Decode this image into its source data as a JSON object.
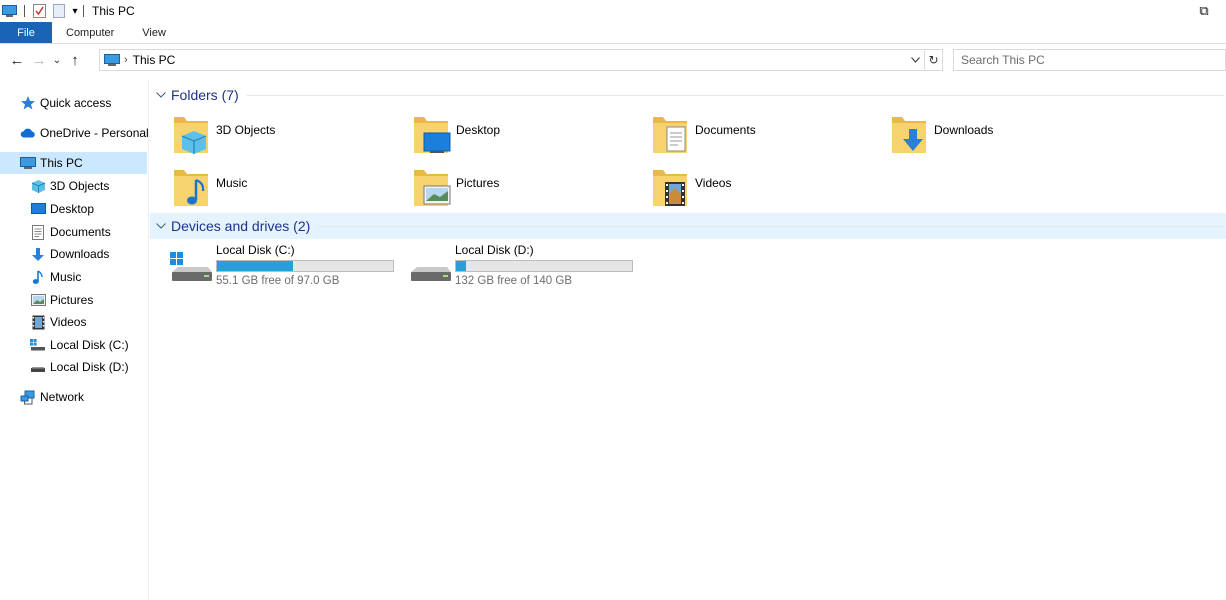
{
  "window": {
    "title": "This PC",
    "restore_glyph": "⧉",
    "qat_icons": [
      "computer-icon",
      "properties-icon",
      "new-folder-icon"
    ],
    "qat_dropdown": "▾"
  },
  "ribbon": {
    "tabs": [
      {
        "label": "File"
      },
      {
        "label": "Computer"
      },
      {
        "label": "View"
      }
    ]
  },
  "navbar": {
    "back": "←",
    "forward": "→",
    "recent": "⌄",
    "up": "↑",
    "breadcrumb_sep": "›",
    "breadcrumb": "This PC",
    "refresh": "↻",
    "search_placeholder": "Search This PC"
  },
  "sidebar": {
    "items": [
      {
        "label": "Quick access",
        "icon": "star-icon"
      },
      {
        "label": "OneDrive - Personal",
        "icon": "cloud-icon"
      },
      {
        "label": "This PC",
        "icon": "computer-icon",
        "selected": true
      },
      {
        "label": "3D Objects",
        "icon": "cube-icon"
      },
      {
        "label": "Desktop",
        "icon": "desktop-icon"
      },
      {
        "label": "Documents",
        "icon": "document-icon"
      },
      {
        "label": "Downloads",
        "icon": "download-icon"
      },
      {
        "label": "Music",
        "icon": "music-icon"
      },
      {
        "label": "Pictures",
        "icon": "picture-icon"
      },
      {
        "label": "Videos",
        "icon": "video-icon"
      },
      {
        "label": "Local Disk (C:)",
        "icon": "windows-drive-icon"
      },
      {
        "label": "Local Disk (D:)",
        "icon": "drive-icon"
      },
      {
        "label": "Network",
        "icon": "network-icon"
      }
    ]
  },
  "folders": {
    "header": "Folders (7)",
    "items": [
      {
        "label": "3D Objects",
        "icon": "folder-3d-objects-icon"
      },
      {
        "label": "Desktop",
        "icon": "folder-desktop-icon"
      },
      {
        "label": "Documents",
        "icon": "folder-documents-icon"
      },
      {
        "label": "Downloads",
        "icon": "folder-downloads-icon"
      },
      {
        "label": "Music",
        "icon": "folder-music-icon"
      },
      {
        "label": "Pictures",
        "icon": "folder-pictures-icon"
      },
      {
        "label": "Videos",
        "icon": "folder-videos-icon"
      }
    ]
  },
  "drives": {
    "header": "Devices and drives (2)",
    "items": [
      {
        "label": "Local Disk (C:)",
        "free_text": "55.1 GB free of 97.0 GB",
        "used_fraction": 0.43,
        "icon": "windows-drive-icon"
      },
      {
        "label": "Local Disk (D:)",
        "free_text": "132 GB free of 140 GB",
        "used_fraction": 0.057,
        "icon": "drive-icon"
      }
    ]
  },
  "colors": {
    "accent": "#1a64b4",
    "selection": "#cce8ff",
    "group_header": "#1e3287",
    "usage_bar": "#26a0da"
  }
}
